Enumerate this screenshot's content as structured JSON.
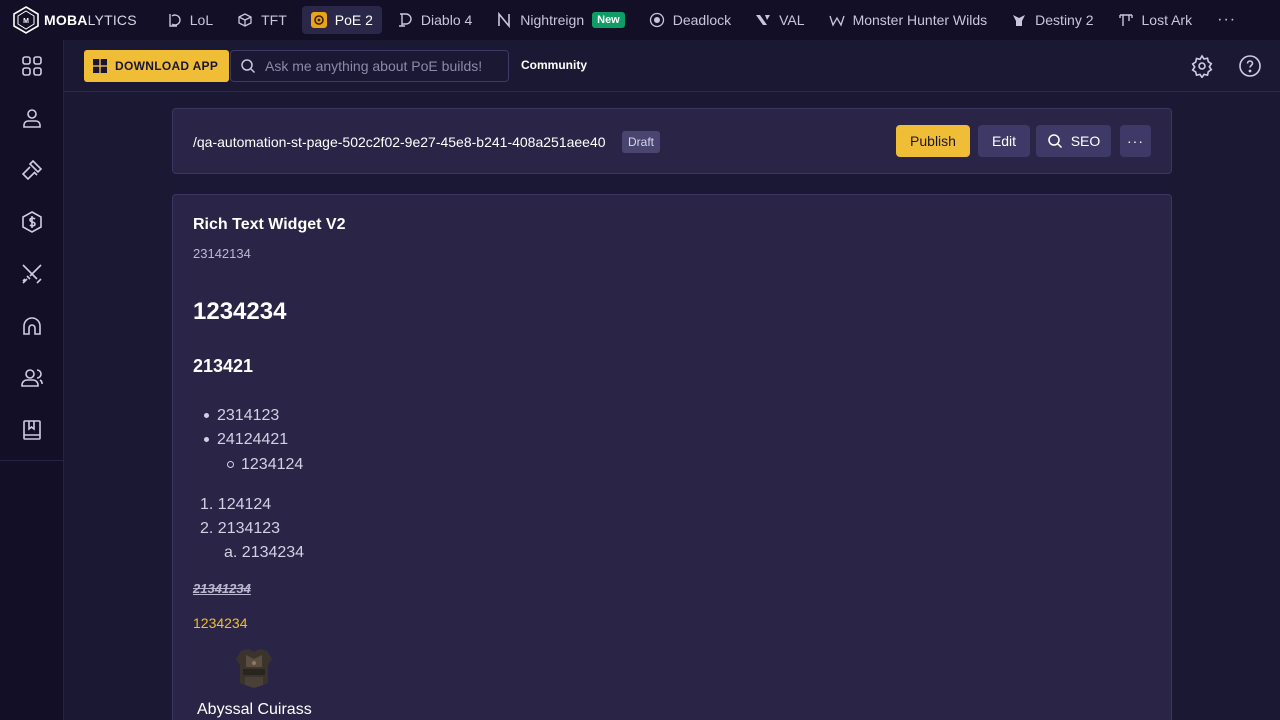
{
  "brand": {
    "name_bold": "MOBA",
    "name_rest": "LYTICS"
  },
  "game_tabs": [
    {
      "label": "LoL",
      "icon": "lol-icon"
    },
    {
      "label": "TFT",
      "icon": "tft-icon"
    },
    {
      "label": "PoE 2",
      "icon": "poe2-icon",
      "active": true
    },
    {
      "label": "Diablo 4",
      "icon": "diablo-icon"
    },
    {
      "label": "Nightreign",
      "icon": "nightreign-icon",
      "badge": "New"
    },
    {
      "label": "Deadlock",
      "icon": "deadlock-icon"
    },
    {
      "label": "VAL",
      "icon": "valorant-icon"
    },
    {
      "label": "Monster Hunter Wilds",
      "icon": "monster-hunter-icon"
    },
    {
      "label": "Destiny 2",
      "icon": "destiny-icon"
    },
    {
      "label": "Lost Ark",
      "icon": "lost-ark-icon"
    }
  ],
  "nav_more": "···",
  "sidebar": [
    "grid-icon",
    "user-icon",
    "hammer-icon",
    "currency-icon",
    "swords-icon",
    "helmet-icon",
    "community-icon",
    "book-icon"
  ],
  "header": {
    "download_label": "DOWNLOAD APP",
    "search_placeholder": "Ask me anything about PoE builds!",
    "community_label": "Community"
  },
  "pathbar": {
    "path": "/qa-automation-st-page-502c2f02-9e27-45e8-b241-408a251aee40",
    "status": "Draft",
    "publish_label": "Publish",
    "edit_label": "Edit",
    "seo_label": "SEO",
    "more_label": "···"
  },
  "widget": {
    "title": "Rich Text Widget V2",
    "subtitle": "23142134",
    "heading1": "1234234",
    "heading2": "213421",
    "bullets": [
      "2314123",
      "24124421"
    ],
    "sub_bullet": "1234124",
    "ordered": [
      "1. 124124",
      "2. 2134123"
    ],
    "sub_ordered": "a. 2134234",
    "strike_text": "21341234",
    "link_text": "1234234",
    "item_name": "Abyssal Cuirass"
  },
  "colors": {
    "accent": "#f0bd37",
    "background": "#1b1833",
    "panel": "#2a2547",
    "nav": "#120f26",
    "new_badge": "#0f9d67"
  }
}
